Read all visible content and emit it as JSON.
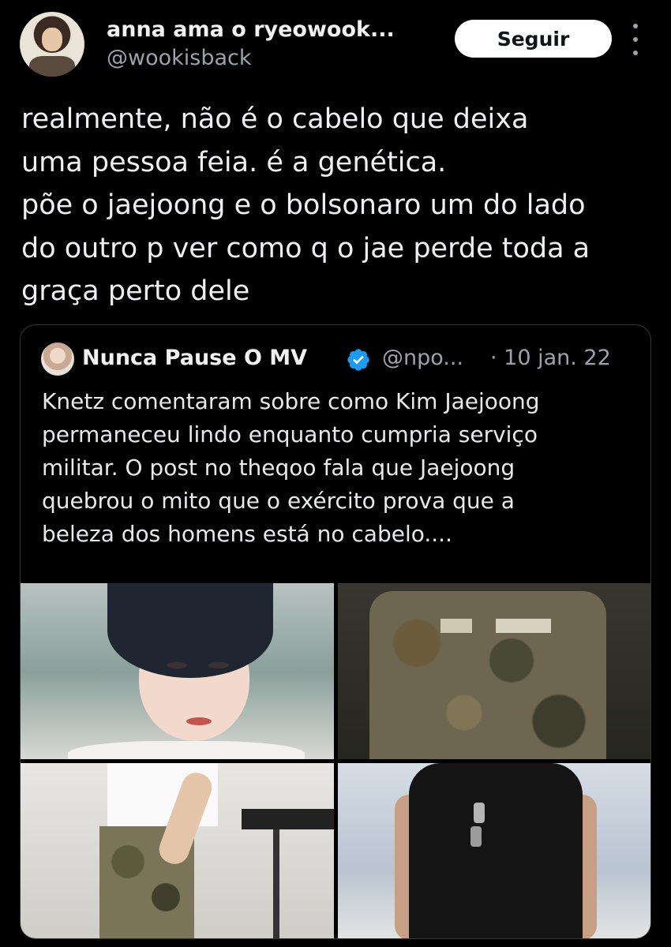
{
  "tweet": {
    "author": {
      "display_name": "anna ama o ryeowook...",
      "handle": "@wookisback"
    },
    "follow_label": "Seguir",
    "more_icon": "more-vertical-icon",
    "text_lines": [
      "realmente, não é o cabelo que deixa",
      "uma pessoa feia. é a genética.",
      "põe o jaejoong e o bolsonaro um do lado",
      "do outro p ver como q o jae perde toda a",
      "graça perto dele"
    ]
  },
  "quoted_tweet": {
    "display_name": "Nunca Pause O MV",
    "verified_icon": "verified-badge-icon",
    "handle": "@npo...",
    "date": "· 10 jan. 22",
    "text_lines": [
      "Knetz comentaram sobre como Kim Jaejoong",
      "permaneceu lindo enquanto cumpria serviço",
      "militar. O post no theqoo fala que Jaejoong",
      "quebrou o mito que o exército prova que a",
      "beleza dos homens está no cabelo...."
    ],
    "media_count": 4
  },
  "colors": {
    "background": "#000000",
    "text": "#e7e9ea",
    "muted": "#9aa3ab",
    "verified": "#1d9bf0",
    "border": "#333639"
  }
}
